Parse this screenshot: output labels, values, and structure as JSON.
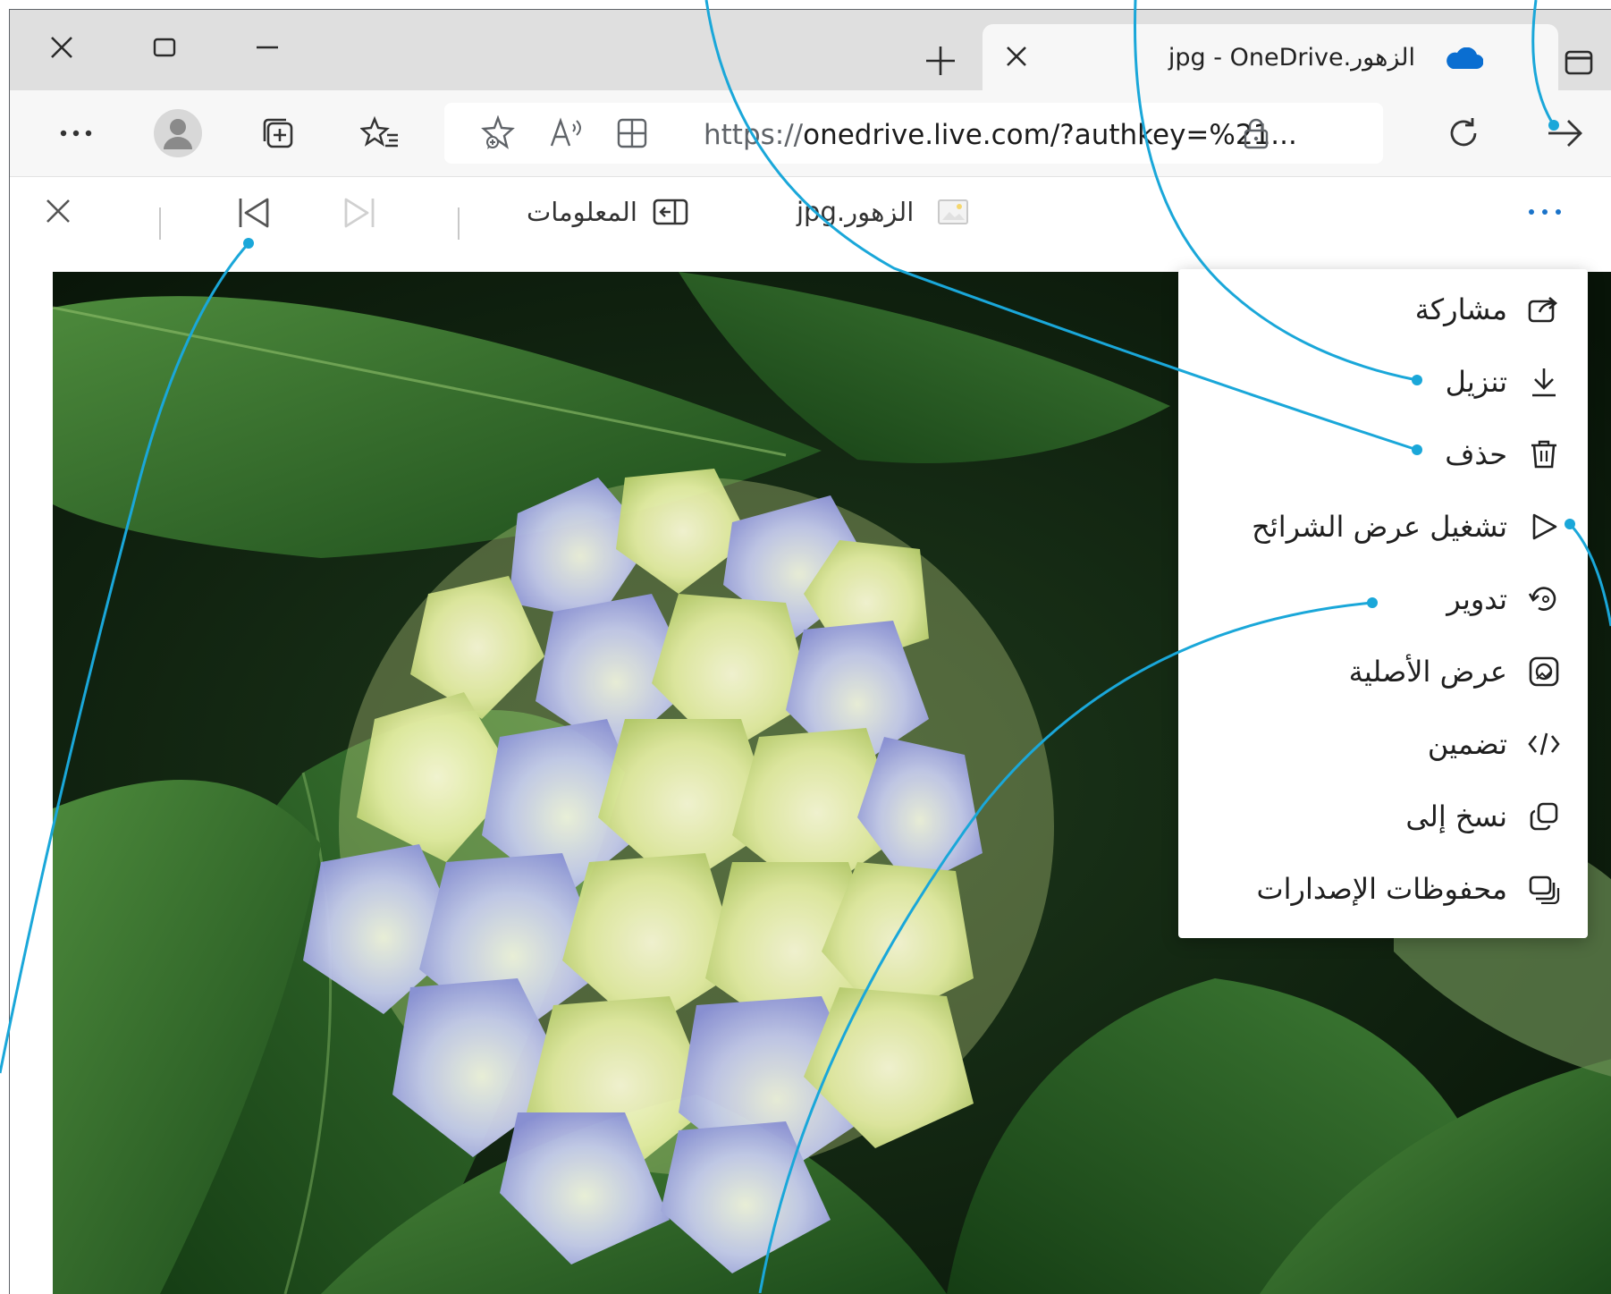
{
  "tab": {
    "title": "الزهور.jpg - OneDrive"
  },
  "address": {
    "url_prefix": "https://",
    "url_main": "onedrive.live.com/?authkey=%21..."
  },
  "viewer": {
    "filename": "الزهور.jpg",
    "info_label": "المعلومات"
  },
  "menu": {
    "items": [
      {
        "label": "مشاركة",
        "icon": "share-icon"
      },
      {
        "label": "تنزيل",
        "icon": "download-icon"
      },
      {
        "label": "حذف",
        "icon": "trash-icon"
      },
      {
        "label": "تشغيل عرض الشرائح",
        "icon": "play-icon"
      },
      {
        "label": "تدوير",
        "icon": "rotate-icon"
      },
      {
        "label": "عرض الأصلية",
        "icon": "original-image-icon"
      },
      {
        "label": "تضمين",
        "icon": "embed-code-icon"
      },
      {
        "label": "نسخ إلى",
        "icon": "copy-icon"
      },
      {
        "label": "محفوظات الإصدارات",
        "icon": "version-history-icon"
      }
    ]
  },
  "colors": {
    "callout": "#1aa7d9",
    "titlebar": "#dfdfdf",
    "onedrive": "#0a6ed1"
  }
}
